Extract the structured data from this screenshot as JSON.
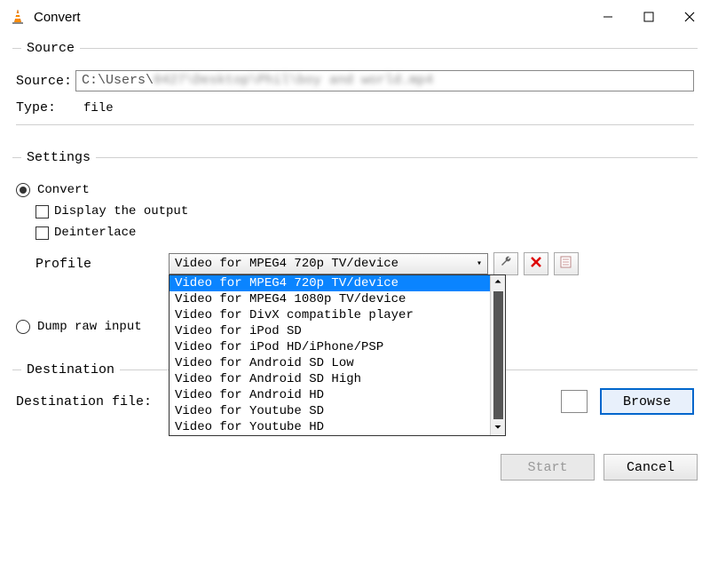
{
  "window": {
    "title": "Convert"
  },
  "source": {
    "legend": "Source",
    "source_label": "Source:",
    "source_value": "C:\\Users\\",
    "type_label": "Type:",
    "type_value": "file"
  },
  "settings": {
    "legend": "Settings",
    "convert_label": "Convert",
    "display_output_label": "Display the output",
    "deinterlace_label": "Deinterlace",
    "profile_label": "Profile",
    "profile_selected": "Video for MPEG4 720p TV/device",
    "profile_options": [
      "Video for MPEG4 720p TV/device",
      "Video for MPEG4 1080p TV/device",
      "Video for DivX compatible player",
      "Video for iPod SD",
      "Video for iPod HD/iPhone/PSP",
      "Video for Android SD Low",
      "Video for Android SD High",
      "Video for Android HD",
      "Video for Youtube SD",
      "Video for Youtube HD"
    ],
    "dump_raw_label": "Dump raw input"
  },
  "destination": {
    "legend": "Destination",
    "file_label": "Destination file:",
    "browse_label": "Browse"
  },
  "buttons": {
    "start": "Start",
    "cancel": "Cancel"
  },
  "icons": {
    "wrench": "wrench-icon",
    "delete": "delete-icon",
    "new": "new-profile-icon"
  }
}
